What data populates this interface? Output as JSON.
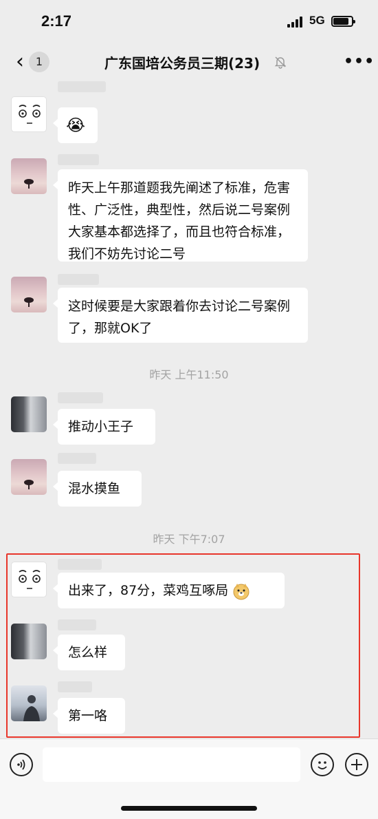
{
  "status_bar": {
    "time": "2:17",
    "network": "5G"
  },
  "nav": {
    "back_icon": "chevron-left-icon",
    "unread_count": "1",
    "title": "广东国培公务员三期(23)",
    "mute_icon": "bell-off-icon",
    "more_icon": "more-icon",
    "more_label": "•••"
  },
  "messages": [
    {
      "avatar": "face-doodle",
      "emoji": "😭"
    },
    {
      "avatar": "sunset-tree",
      "text": "昨天上午那道题我先阐述了标准，危害性、广泛性，典型性，然后说二号案例大家基本都选择了，而且也符合标准，我们不妨先讨论二号"
    },
    {
      "avatar": "sunset-tree",
      "text": "这时候要是大家跟着你去讨论二号案例了，那就OK了"
    },
    {
      "timestamp": "昨天 上午11:50"
    },
    {
      "avatar": "room-photo",
      "text": "推动小王子"
    },
    {
      "avatar": "sunset-tree",
      "text": "混水摸鱼"
    },
    {
      "timestamp": "昨天 下午7:07"
    },
    {
      "avatar": "face-doodle",
      "text": "出来了，87分，菜鸡互啄局",
      "emoji": "doge-face"
    },
    {
      "avatar": "room-photo",
      "text": "怎么样"
    },
    {
      "avatar": "person-photo",
      "text": "第一咯"
    }
  ],
  "highlight_color": "#e8352a",
  "input_bar": {
    "voice_icon": "voice-icon",
    "emoji_icon": "emoji-icon",
    "plus_icon": "plus-icon"
  }
}
